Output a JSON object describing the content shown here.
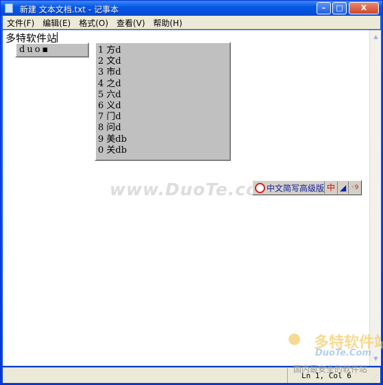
{
  "window": {
    "title": "新建 文本文档.txt - 记事本",
    "minimize": "–",
    "maximize": "□",
    "close": "X"
  },
  "menu": [
    "文件(F)",
    "编辑(E)",
    "格式(O)",
    "查看(V)",
    "帮助(H)"
  ],
  "editor": {
    "text": "多特软件站"
  },
  "ime": {
    "composition": "duo",
    "candidates": [
      "1 方d",
      "2 文d",
      "3 市d",
      "4 之d",
      "5 六d",
      "6 义d",
      "7 门d",
      "8 问d",
      "9 美db",
      "0 关db"
    ],
    "status": {
      "name": "中文简写高级版",
      "mode": "中",
      "punct": "◢",
      "skin": "◦9"
    }
  },
  "watermark": {
    "text": "www.DuoTe.com",
    "logo_cn": "多特软件站",
    "logo_en": "DuoTe.Com",
    "slogan": "国内最安全的软件站"
  },
  "statusbar": {
    "position": "Ln 1, Col 6"
  }
}
